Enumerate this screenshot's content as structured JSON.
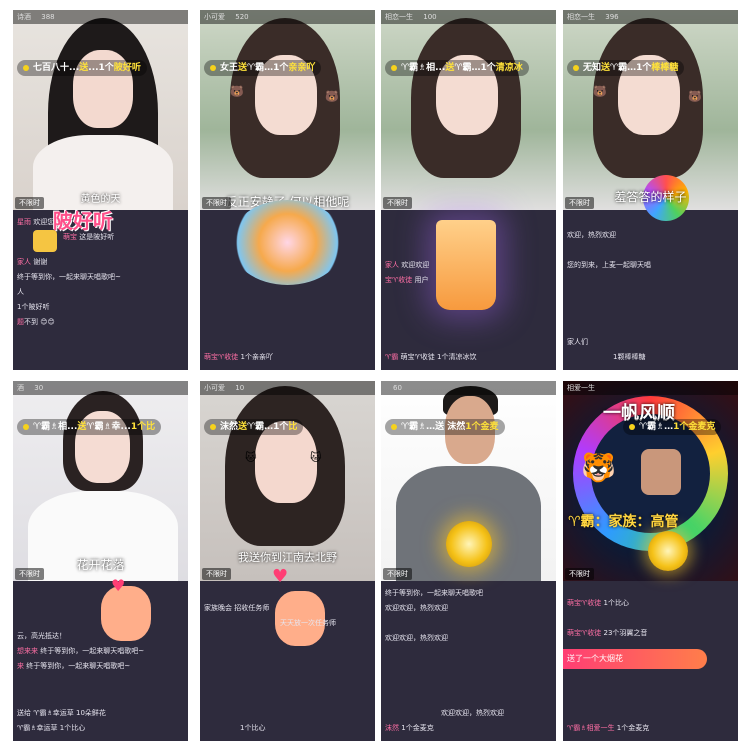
{
  "panels": [
    {
      "topbar": {
        "name": "诗酒",
        "users": "388"
      },
      "banner": {
        "pre": "七百八十...",
        "verb": "送",
        "mid": "...1个",
        "post": "陂好听"
      },
      "photo_text": "黄色的天",
      "gift_label": "陂好听",
      "tag": "不限时",
      "chat": [
        {
          "user": "星雨",
          "text": "欢迎您"
        },
        {
          "user": "萌宝",
          "text": "这是陂好听"
        },
        {
          "user": "",
          "text": ""
        },
        {
          "user": "家人",
          "text": "谢谢"
        },
        {
          "user": "",
          "text": ""
        },
        {
          "user": "",
          "text": "终于等到你，一起来聊天唱歌吧~"
        },
        {
          "user": "",
          "text": "人"
        },
        {
          "user": "",
          "text": ""
        },
        {
          "user": "",
          "text": "1个陂好听"
        },
        {
          "user": "题",
          "text": "不到"
        }
      ]
    },
    {
      "topbar": {
        "name": "小可爱",
        "users": "520"
      },
      "banner": {
        "pre": "女王",
        "verb": "送",
        "mid": "♈霸…1个",
        "post": "亲亲吖"
      },
      "photo_text": "反正安静了 何以相他呢",
      "tag": "不限时",
      "chat": [
        {
          "user": "",
          "text": ""
        },
        {
          "user": "",
          "text": ""
        },
        {
          "user": "",
          "text": ""
        },
        {
          "user": "",
          "text": ""
        },
        {
          "user": "",
          "text": ""
        },
        {
          "user": "",
          "text": ""
        },
        {
          "user": "",
          "text": ""
        },
        {
          "user": "",
          "text": ""
        },
        {
          "user": "",
          "text": ""
        },
        {
          "user": "萌宝♈收徒",
          "text": "1个亲亲吖"
        }
      ]
    },
    {
      "topbar": {
        "name": "相恋一生",
        "users": "100"
      },
      "banner": {
        "pre": "♈霸♗相...",
        "verb": "送",
        "mid": "♈霸…1个",
        "post": "清凉冰"
      },
      "photo_text": "",
      "tag": "不限时",
      "chat": [
        {
          "user": "",
          "text": ""
        },
        {
          "user": "",
          "text": ""
        },
        {
          "user": "",
          "text": ""
        },
        {
          "user": "家人",
          "text": "欢迎欢迎"
        },
        {
          "user": "宝♈收徒",
          "text": "用户"
        },
        {
          "user": "",
          "text": ""
        },
        {
          "user": "",
          "text": ""
        },
        {
          "user": "",
          "text": ""
        },
        {
          "user": "",
          "text": ""
        },
        {
          "user": "♈霸",
          "text": "萌宝♈收徒 1个清凉冰饮"
        }
      ]
    },
    {
      "topbar": {
        "name": "相恋一生",
        "users": "396"
      },
      "banner": {
        "pre": "无知",
        "verb": "送",
        "mid": "♈霸…1个",
        "post": "棒棒糖"
      },
      "photo_text": "羞答答的样子",
      "tag": "不限时",
      "chat": [
        {
          "user": "",
          "text": ""
        },
        {
          "user": "",
          "text": "欢迎，热烈欢迎"
        },
        {
          "user": "",
          "text": ""
        },
        {
          "user": "",
          "text": "您的到来，上麦一起聊天唱"
        },
        {
          "user": "",
          "text": ""
        },
        {
          "user": "",
          "text": ""
        },
        {
          "user": "",
          "text": ""
        },
        {
          "user": "",
          "text": "家人们"
        },
        {
          "user": "",
          "text": ""
        },
        {
          "user": "",
          "text": "1颗棒棒糖"
        }
      ]
    },
    {
      "topbar": {
        "name": "酒",
        "users": "30"
      },
      "banner": {
        "pre": "♈霸♗相...",
        "verb": "送",
        "mid": "♈霸♗幸...",
        "post": "1个比"
      },
      "photo_text": "花开花落",
      "tag": "不限时",
      "chat": [
        {
          "user": "",
          "text": ""
        },
        {
          "user": "",
          "text": ""
        },
        {
          "user": "",
          "text": "云，高光抵达！"
        },
        {
          "user": "想来来",
          "text": "终于等到你，一起来聊天唱歌吧~"
        },
        {
          "user": "来",
          "text": "终于等到你，一起来聊天唱歌吧~"
        },
        {
          "user": "",
          "text": ""
        },
        {
          "user": "",
          "text": ""
        },
        {
          "user": "",
          "text": ""
        },
        {
          "user": "",
          "text": "送给 ♈霸♗幸运草 10朵鲜花"
        },
        {
          "user": "",
          "text": "♈霸♗幸运草 1个比心"
        }
      ]
    },
    {
      "topbar": {
        "name": "小可爱",
        "users": "10"
      },
      "banner": {
        "pre": "沫然",
        "verb": "送",
        "mid": "♈霸…1个",
        "post": "比"
      },
      "photo_text": "我送你到江南去北野",
      "tag": "不限时",
      "chat": [
        {
          "user": "",
          "text": "家族晚会 招收任务师"
        },
        {
          "user": "",
          "text": "天天放一次任务师"
        },
        {
          "user": "",
          "text": ""
        },
        {
          "user": "",
          "text": ""
        },
        {
          "user": "",
          "text": ""
        },
        {
          "user": "",
          "text": ""
        },
        {
          "user": "",
          "text": ""
        },
        {
          "user": "",
          "text": ""
        },
        {
          "user": "",
          "text": ""
        },
        {
          "user": "",
          "text": "1个比心"
        }
      ]
    },
    {
      "topbar": {
        "name": "",
        "users": "60"
      },
      "banner": {
        "pre": "♈霸♗…",
        "verb": "",
        "mid": "送 沫然",
        "post": "1个金麦"
      },
      "photo_text": "",
      "tag": "不限时",
      "chat": [
        {
          "user": "",
          "text": "终于等到你，一起来聊天唱歌吧"
        },
        {
          "user": "",
          "text": "欢迎欢迎，热烈欢迎"
        },
        {
          "user": "",
          "text": ""
        },
        {
          "user": "",
          "text": "欢迎欢迎，热烈欢迎"
        },
        {
          "user": "",
          "text": ""
        },
        {
          "user": "",
          "text": ""
        },
        {
          "user": "",
          "text": ""
        },
        {
          "user": "",
          "text": ""
        },
        {
          "user": "",
          "text": "欢迎欢迎，热烈欢迎"
        },
        {
          "user": "沫然",
          "text": "1个金麦克"
        }
      ]
    },
    {
      "topbar": {
        "name": "相爱一生",
        "users": ""
      },
      "banner": {
        "pre": "♈霸♗…",
        "verb": "",
        "mid": "",
        "post": "1个金麦克"
      },
      "photo_text": "一帆风顺",
      "photo_sub": "♈霸：家族：高管",
      "tag": "不限时",
      "chat": [
        {
          "user": "",
          "text": ""
        },
        {
          "user": "萌宝♈收徒",
          "text": "1个比心"
        },
        {
          "user": "",
          "text": ""
        },
        {
          "user": "萌宝♈收徒",
          "text": "23个羽翼之音"
        },
        {
          "user": "",
          "text": "送了一个大烟花"
        },
        {
          "user": "",
          "text": ""
        },
        {
          "user": "",
          "text": ""
        },
        {
          "user": "",
          "text": ""
        },
        {
          "user": "",
          "text": ""
        },
        {
          "user": "♈霸♗相爱一生",
          "text": "1个金麦克"
        }
      ]
    }
  ],
  "colors": {
    "panel_bg": "#2e2b3d",
    "highlight": "#ffe23a",
    "user": "#ff6fa5"
  }
}
